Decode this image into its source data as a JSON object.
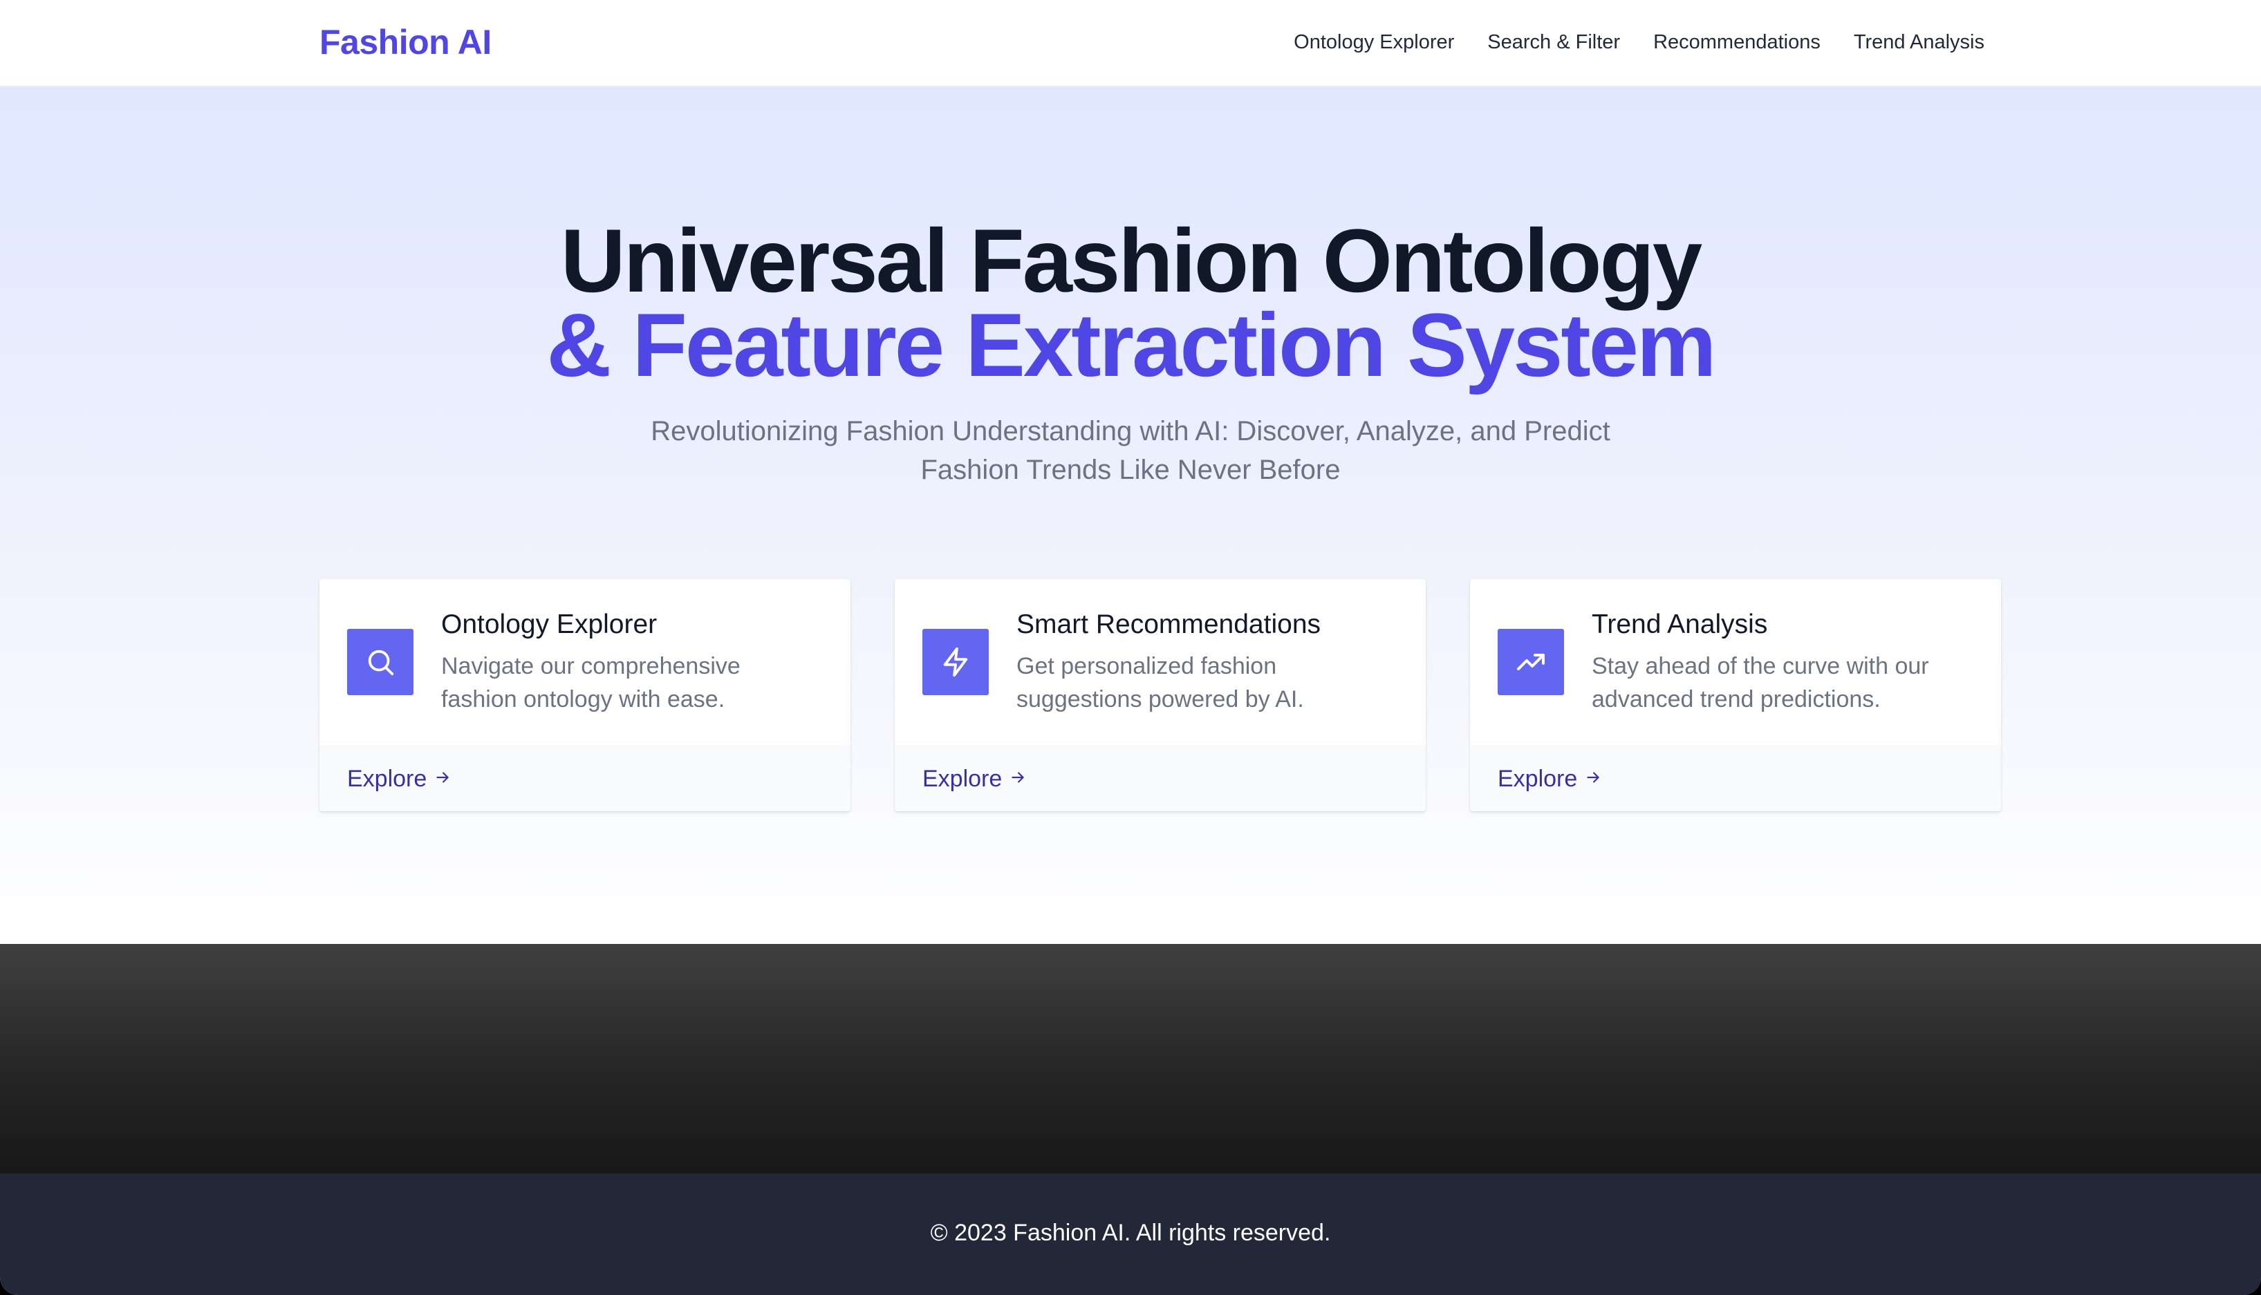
{
  "nav": {
    "brand": "Fashion AI",
    "links": [
      "Ontology Explorer",
      "Search & Filter",
      "Recommendations",
      "Trend Analysis"
    ]
  },
  "hero": {
    "title_line1": "Universal Fashion Ontology",
    "title_line2": "& Feature Extraction System",
    "subtitle": "Revolutionizing Fashion Understanding with AI: Discover, Analyze, and Predict Fashion Trends Like Never Before"
  },
  "cards": [
    {
      "icon": "search-icon",
      "title": "Ontology Explorer",
      "description": "Navigate our comprehensive fashion ontology with ease.",
      "link": "Explore"
    },
    {
      "icon": "lightning-icon",
      "title": "Smart Recommendations",
      "description": "Get personalized fashion suggestions powered by AI.",
      "link": "Explore"
    },
    {
      "icon": "trending-up-icon",
      "title": "Trend Analysis",
      "description": "Stay ahead of the curve with our advanced trend predictions.",
      "link": "Explore"
    }
  ],
  "footer": {
    "copyright": "© 2023 Fashion AI. All rights reserved."
  },
  "colors": {
    "accent": "#4f46e5",
    "icon_bg": "#6366f1",
    "link": "#3730a3",
    "footer_bg": "#222838"
  }
}
